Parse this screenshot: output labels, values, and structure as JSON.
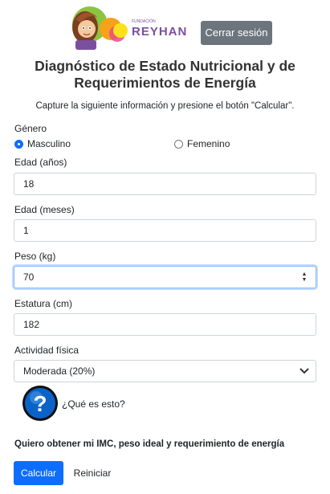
{
  "header": {
    "logo": {
      "small_text": "FUNDACIÓN",
      "name": "REYHAN"
    },
    "logout_label": "Cerrar sesión"
  },
  "page": {
    "title_line1": "Diagnóstico de Estado Nutricional y de",
    "title_line2": "Requerimientos de Energía",
    "subtitle": "Capture la siguiente información y presione el botón \"Calcular\"."
  },
  "form": {
    "gender": {
      "label": "Género",
      "options": [
        {
          "label": "Masculino",
          "checked": true
        },
        {
          "label": "Femenino",
          "checked": false
        }
      ]
    },
    "age_years": {
      "label": "Edad (años)",
      "value": "18"
    },
    "age_months": {
      "label": "Edad (meses)",
      "value": "1"
    },
    "weight": {
      "label": "Peso (kg)",
      "value": "70"
    },
    "height": {
      "label": "Estatura (cm)",
      "value": "182"
    },
    "activity": {
      "label": "Actividad física",
      "value": "Moderada (20%)"
    }
  },
  "help": {
    "icon": "question-icon",
    "label": "¿Qué es esto?"
  },
  "result_intro": "Quiero obtener mi IMC, peso ideal y requerimiento de energía",
  "actions": {
    "calculate_label": "Calcular",
    "reset_label": "Reiniciar"
  },
  "colors": {
    "primary": "#0d6efd",
    "secondary": "#6c757d",
    "help_blue": "#0b63c9"
  }
}
